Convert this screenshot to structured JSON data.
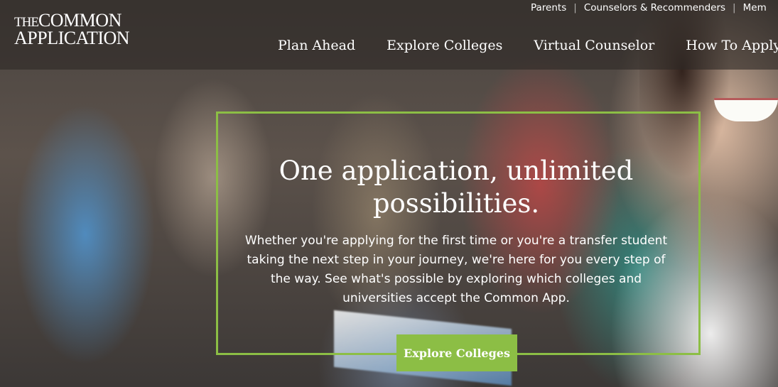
{
  "logo": {
    "line1_prefix": "THE",
    "line1_main": "COMMON",
    "line2": "APPLICATION"
  },
  "utility_nav": [
    "Parents",
    "Counselors & Recommenders",
    "Mem"
  ],
  "main_nav": [
    "Plan Ahead",
    "Explore Colleges",
    "Virtual Counselor",
    "How To Apply"
  ],
  "hero": {
    "title": "One application, unlimited possibilities.",
    "body": "Whether you're applying for the first time or you're a transfer student taking the next step in your journey, we're here for you every step of the way. See what's possible by exploring which colleges and universities accept the Common App.",
    "cta_label": "Explore Colleges"
  },
  "colors": {
    "accent": "#8cbe45",
    "nav_overlay": "rgba(45,40,37,0.62)",
    "text": "#ffffff"
  }
}
